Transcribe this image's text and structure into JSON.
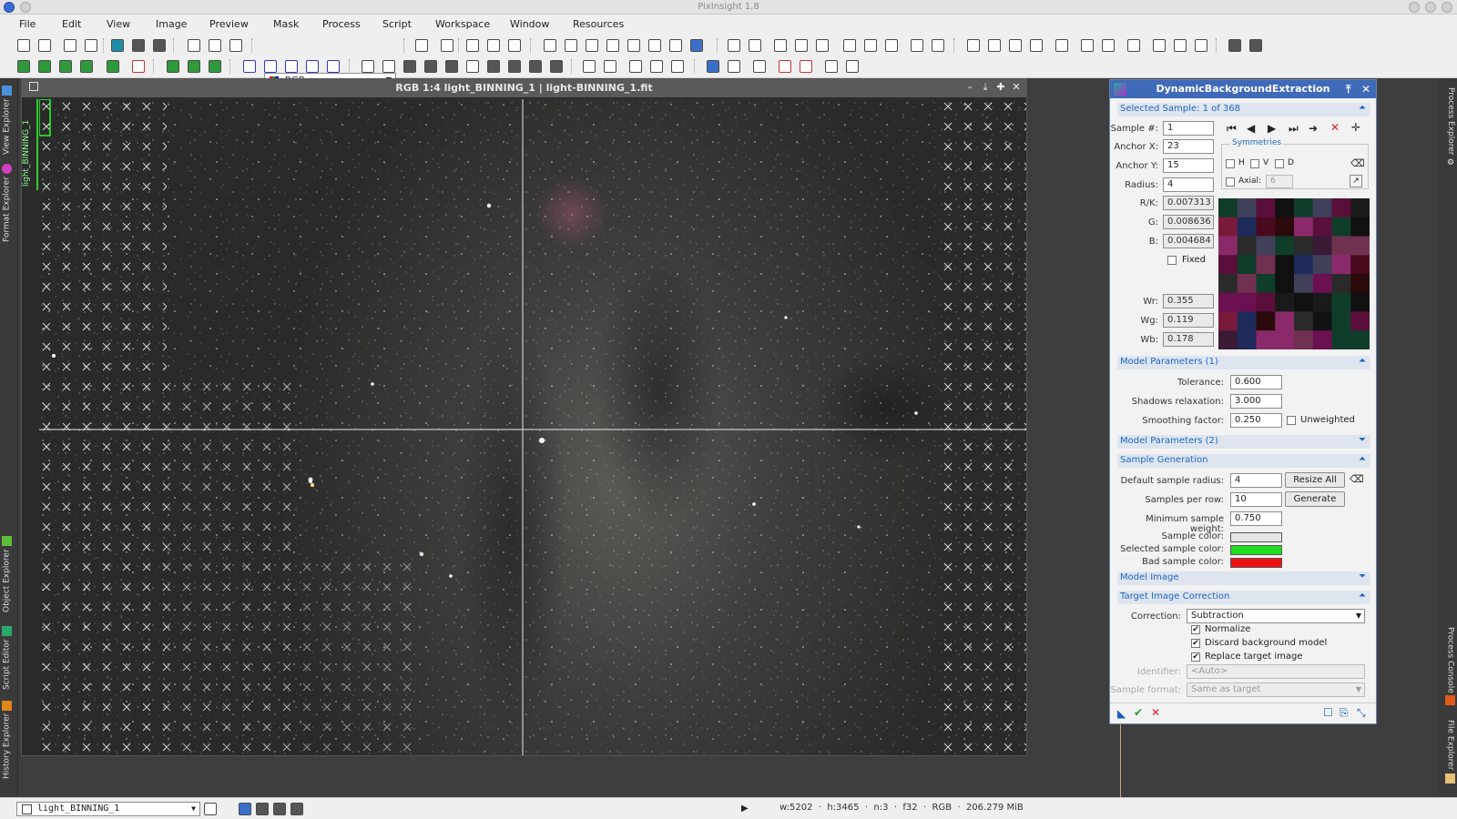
{
  "app": {
    "title": "PixInsight 1.8"
  },
  "menu": [
    "File",
    "Edit",
    "View",
    "Image",
    "Preview",
    "Mask",
    "Process",
    "Script",
    "Workspace",
    "Window",
    "Resources"
  ],
  "toolbar": {
    "color_mode": "RGB"
  },
  "left_tabs": {
    "view_explorer": "View Explorer",
    "format_explorer": "Format Explorer",
    "object_explorer": "Object Explorer",
    "script_editor": "Script Editor",
    "history_explorer": "History Explorer"
  },
  "right_tabs": {
    "process_explorer": "Process Explorer",
    "process_console": "Process Console",
    "file_explorer": "File Explorer"
  },
  "image_window": {
    "title": "RGB 1:4 light_BINNING_1 | light-BINNING_1.fit",
    "view_id": "light_BINNING_1"
  },
  "dbe": {
    "title": "DynamicBackgroundExtraction",
    "selected_sample": "Selected Sample: 1 of 368",
    "labels": {
      "sample": "Sample #:",
      "anchor_x": "Anchor X:",
      "anchor_y": "Anchor Y:",
      "radius": "Radius:",
      "rk": "R/K:",
      "g": "G:",
      "b": "B:",
      "fixed": "Fixed",
      "wr": "Wr:",
      "wg": "Wg:",
      "wb": "Wb:",
      "symmetries": "Symmetries",
      "h": "H",
      "v": "V",
      "d": "D",
      "axial": "Axial:"
    },
    "values": {
      "sample": "1",
      "anchor_x": "23",
      "anchor_y": "15",
      "radius": "4",
      "rk": "0.007313",
      "g": "0.008636",
      "b": "0.004684",
      "wr": "0.355",
      "wg": "0.119",
      "wb": "0.178",
      "axial": "6"
    },
    "model_params_1": {
      "title": "Model Parameters (1)",
      "tolerance_label": "Tolerance:",
      "tolerance": "0.600",
      "shadows_label": "Shadows relaxation:",
      "shadows": "3.000",
      "smoothing_label": "Smoothing factor:",
      "smoothing": "0.250",
      "unweighted": "Unweighted"
    },
    "model_params_2": {
      "title": "Model Parameters (2)"
    },
    "sample_generation": {
      "title": "Sample Generation",
      "default_radius_label": "Default sample radius:",
      "default_radius": "4",
      "resize_all": "Resize All",
      "per_row_label": "Samples per row:",
      "per_row": "10",
      "generate": "Generate",
      "min_weight_label": "Minimum sample weight:",
      "min_weight": "0.750",
      "sample_color_label": "Sample color:",
      "selected_color_label": "Selected sample color:",
      "bad_color_label": "Bad sample color:"
    },
    "model_image": {
      "title": "Model Image"
    },
    "target": {
      "title": "Target Image Correction",
      "correction_label": "Correction:",
      "correction": "Subtraction",
      "normalize": "Normalize",
      "discard": "Discard background model",
      "replace": "Replace target image",
      "identifier_label": "Identifier:",
      "identifier": "<Auto>",
      "format_label": "Sample format:",
      "format": "Same as target"
    }
  },
  "colors": {
    "sample": "#e6e6e6",
    "selected_sample": "#22dd22",
    "bad_sample": "#ee1111",
    "panel_header": "#3f6ab8"
  },
  "statusbar": {
    "view": "light_BINNING_1",
    "info": "w:5202  ·  h:3465  ·  n:3  ·  f32  ·  RGB  ·  206.279 MiB"
  }
}
